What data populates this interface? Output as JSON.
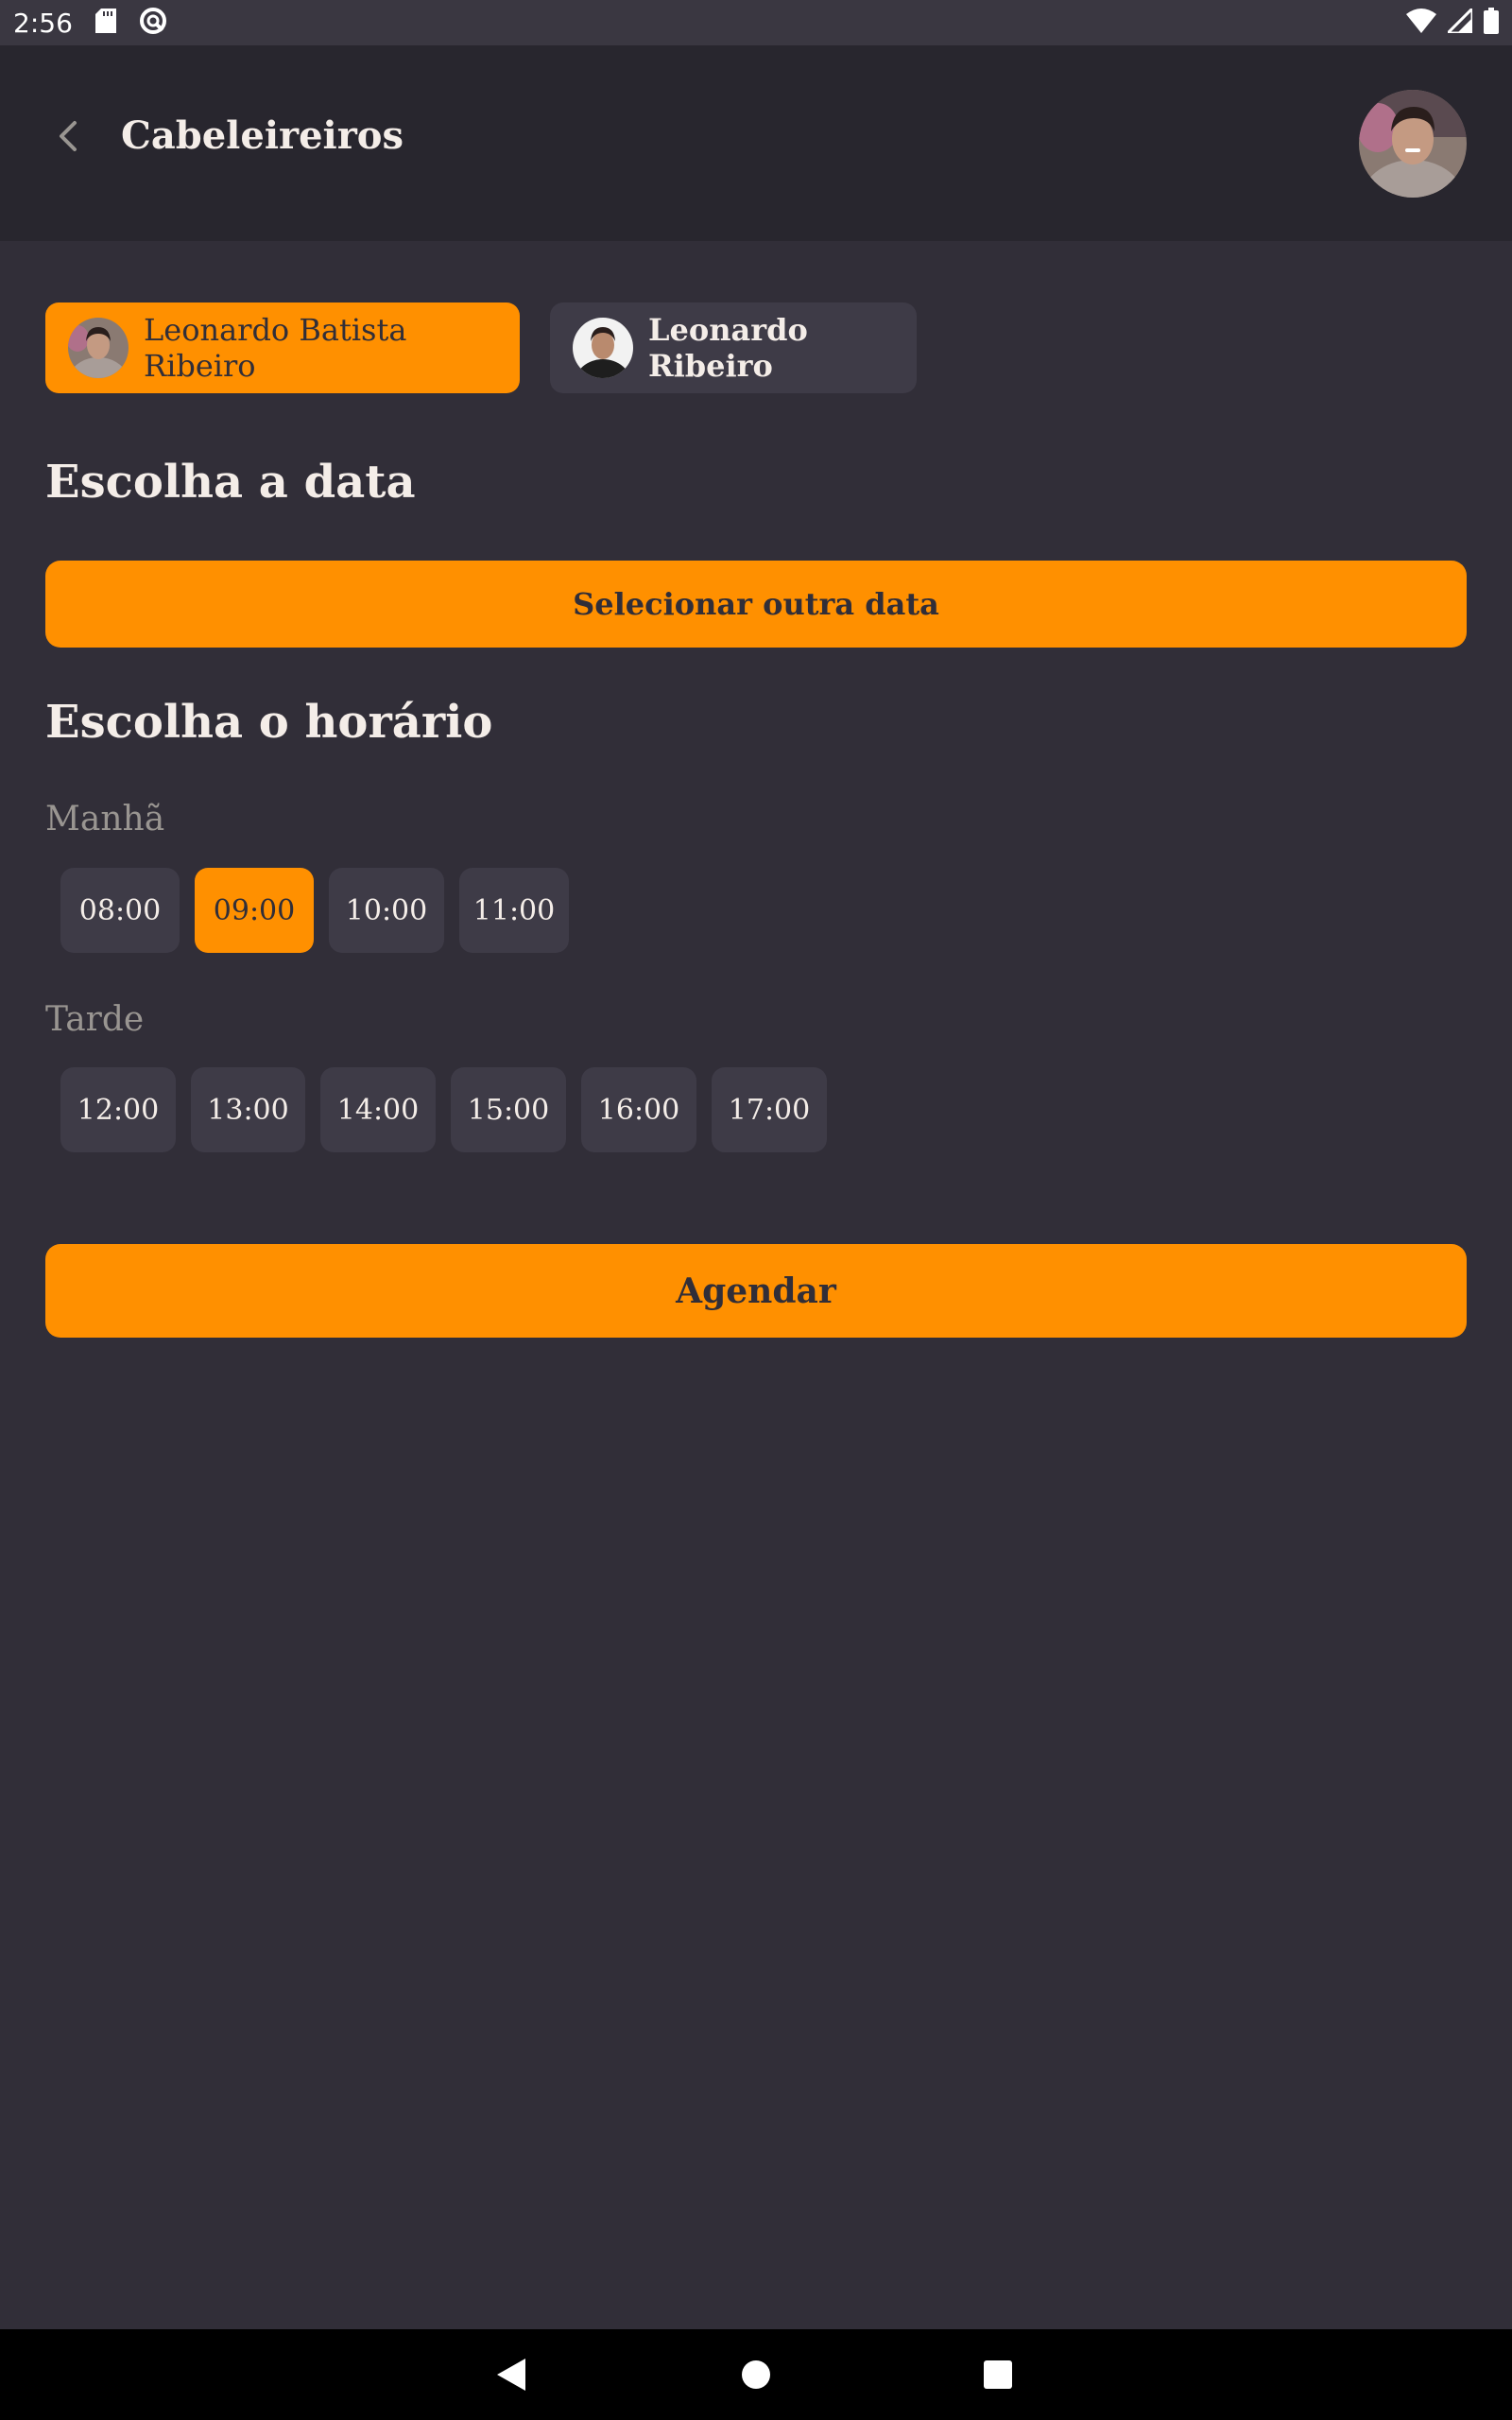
{
  "status_bar": {
    "time": "2:56"
  },
  "header": {
    "title": "Cabeleireiros"
  },
  "providers": [
    {
      "name": "Leonardo Batista Ribeiro",
      "selected": true
    },
    {
      "name": "Leonardo Ribeiro",
      "selected": false
    }
  ],
  "date_section": {
    "title": "Escolha a data",
    "select_button_label": "Selecionar outra data"
  },
  "time_section": {
    "title": "Escolha o horário",
    "morning_label": "Manhã",
    "morning_slots": [
      "08:00",
      "09:00",
      "10:00",
      "11:00"
    ],
    "afternoon_label": "Tarde",
    "afternoon_slots": [
      "12:00",
      "13:00",
      "14:00",
      "15:00",
      "16:00",
      "17:00"
    ],
    "selected_slot": "09:00"
  },
  "submit_label": "Agendar",
  "colors": {
    "accent": "#ff9000",
    "background": "#312e38",
    "header_background": "#28262e",
    "chip_background": "#3e3b47",
    "muted_text": "#999591"
  },
  "icons": {
    "status_left": [
      "sd-card-icon",
      "sync-icon"
    ],
    "status_right": [
      "wifi-icon",
      "cell-signal-icon",
      "battery-icon"
    ],
    "nav": [
      "nav-back-icon",
      "nav-home-icon",
      "nav-recents-icon"
    ]
  }
}
